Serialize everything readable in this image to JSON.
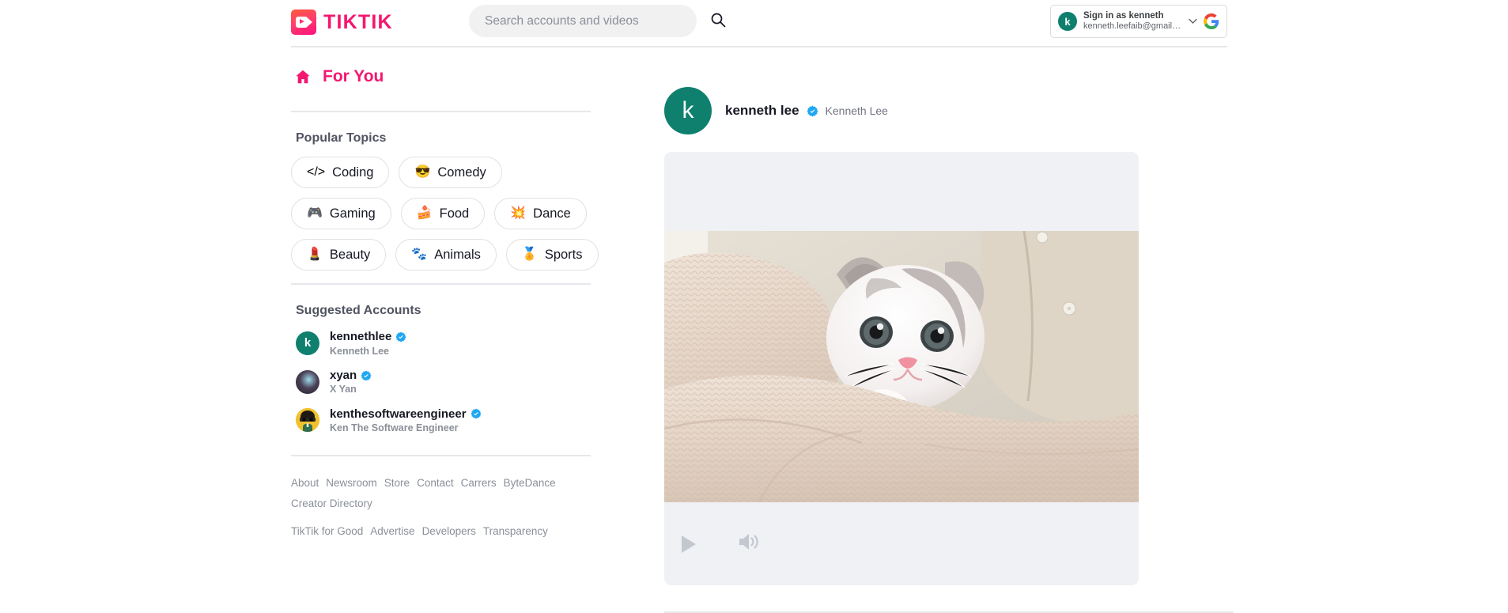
{
  "brand": {
    "name": "TIKTIK",
    "logo_icon": "video-camera-icon",
    "accent_color": "#f3186f"
  },
  "header": {
    "search": {
      "placeholder": "Search accounts and videos",
      "value": "",
      "icon": "search-icon"
    },
    "google_signin": {
      "avatar_letter": "k",
      "line1": "Sign in as kenneth",
      "line2": "kenneth.leefaib@gmail.com",
      "caret_icon": "chevron-down-icon",
      "google_icon": "google-g-icon"
    }
  },
  "sidebar": {
    "for_you": {
      "label": "For You",
      "icon": "home-icon"
    },
    "popular_topics": {
      "title": "Popular Topics",
      "rows": [
        [
          {
            "label": "Coding",
            "emoji": "</>",
            "icon": "code-brackets-icon"
          },
          {
            "label": "Comedy",
            "emoji": "😎",
            "icon": "sunglasses-face-icon"
          }
        ],
        [
          {
            "label": "Gaming",
            "emoji": "🎮",
            "icon": "gamepad-icon"
          },
          {
            "label": "Food",
            "emoji": "🍰",
            "icon": "cake-slice-icon"
          },
          {
            "label": "Dance",
            "emoji": "💥",
            "icon": "sparkle-icon"
          }
        ],
        [
          {
            "label": "Beauty",
            "emoji": "💄",
            "icon": "lipstick-icon"
          },
          {
            "label": "Animals",
            "emoji": "🐾",
            "icon": "paw-print-icon"
          },
          {
            "label": "Sports",
            "emoji": "🏅",
            "icon": "medal-icon"
          }
        ]
      ]
    },
    "suggested_accounts": {
      "title": "Suggested Accounts",
      "items": [
        {
          "handle": "kennethlee",
          "full_name": "Kenneth Lee",
          "avatar_letter": "k",
          "avatar_color": "#0f7f6e",
          "verified": true
        },
        {
          "handle": "xyan",
          "full_name": "X Yan",
          "avatar_letter": "",
          "avatar_color": "#3a3540",
          "verified": true
        },
        {
          "handle": "kenthesoftwareengineer",
          "full_name": "Ken The Software Engineer",
          "avatar_letter": "",
          "avatar_color": "#f2c12e",
          "verified": true
        }
      ]
    },
    "footer": {
      "group1": [
        "About",
        "Newsroom",
        "Store",
        "Contact",
        "Carrers",
        "ByteDance"
      ],
      "group2": [
        "Creator Directory"
      ],
      "group3": [
        "TikTik for Good",
        "Advertise",
        "Developers",
        "Transparency"
      ]
    }
  },
  "feed": {
    "posts": [
      {
        "handle": "kenneth lee",
        "full_name": "Kenneth Lee",
        "avatar_letter": "k",
        "avatar_color": "#0f7f6e",
        "verified": true,
        "video": {
          "play_icon": "play-icon",
          "volume_icon": "volume-on-icon",
          "state": "paused",
          "content_description": "kitten wrapped in cream knit blanket"
        }
      }
    ]
  }
}
